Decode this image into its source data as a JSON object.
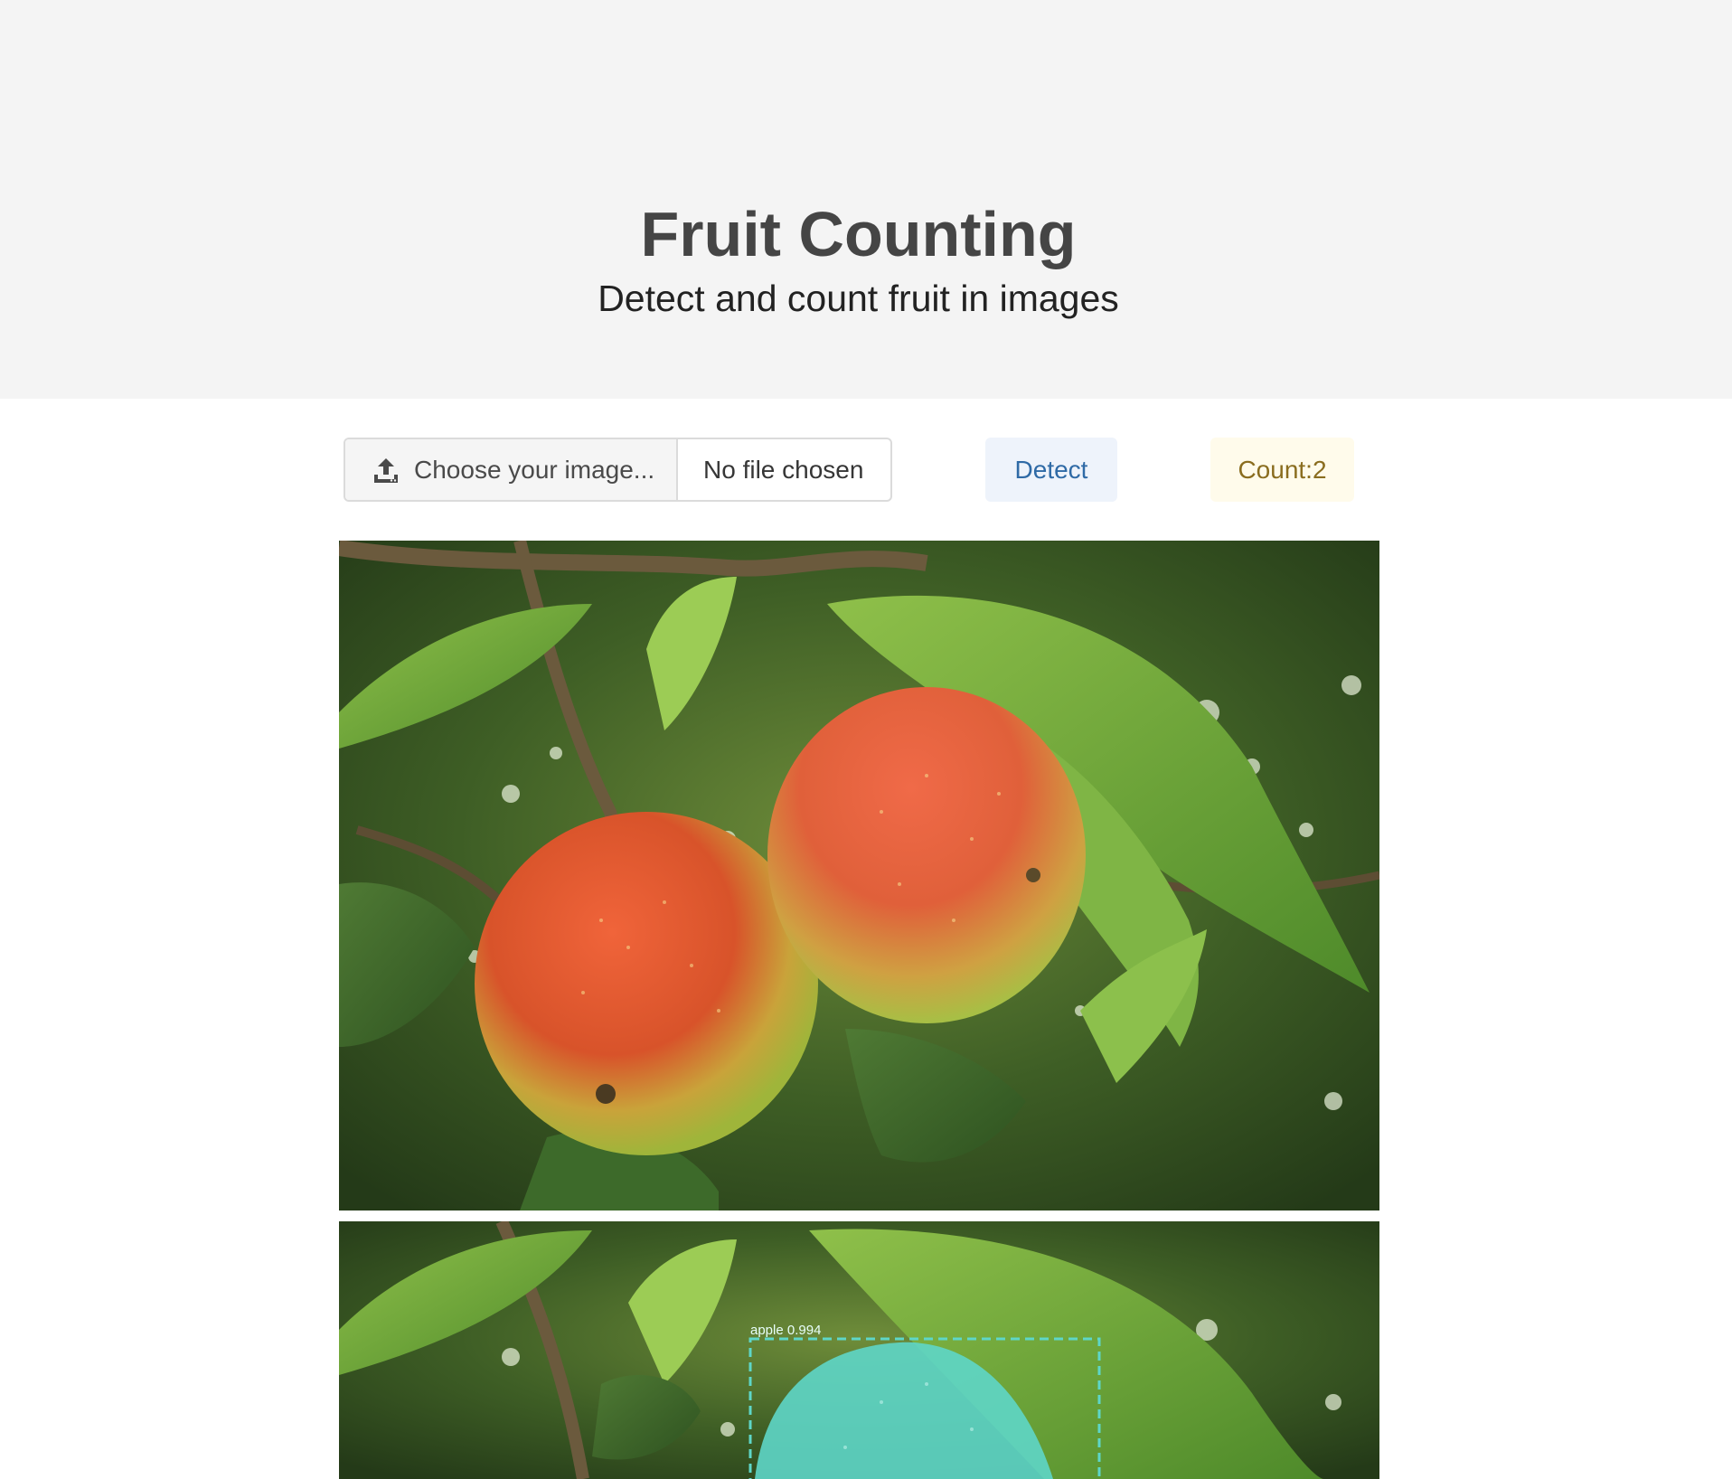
{
  "hero": {
    "title": "Fruit Counting",
    "subtitle": "Detect and count fruit in images"
  },
  "upload": {
    "icon": "upload-icon",
    "choose_label": "Choose your image...",
    "file_name": "No file chosen"
  },
  "actions": {
    "detect_label": "Detect",
    "count_label": "Count:2"
  },
  "colors": {
    "hero_background": "#f4f4f4",
    "detect_background": "#eef3fb",
    "detect_text": "#2f6aa6",
    "count_background": "#fffbeb",
    "count_text": "#8a6d1f",
    "detection_mask": "#5ed6c8"
  },
  "detections": [
    {
      "label": "apple 0.994"
    }
  ]
}
